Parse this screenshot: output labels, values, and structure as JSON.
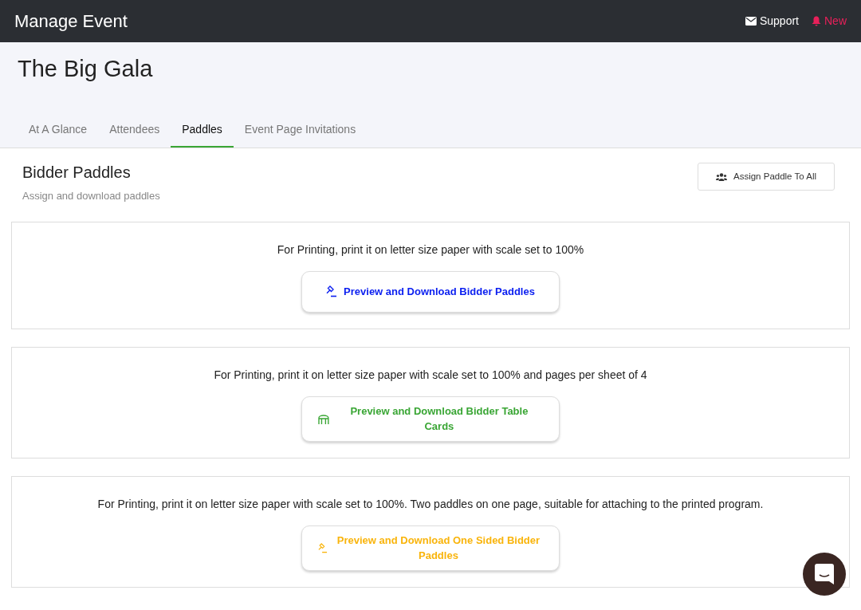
{
  "navbar": {
    "title": "Manage Event",
    "support": "Support",
    "new": "New"
  },
  "event": {
    "title": "The Big Gala"
  },
  "tabs": [
    {
      "label": "At A Glance",
      "selected": false
    },
    {
      "label": "Attendees",
      "selected": false
    },
    {
      "label": "Paddles",
      "selected": true
    },
    {
      "label": "Event Page Invitations",
      "selected": false
    }
  ],
  "section": {
    "title": "Bidder Paddles",
    "subtitle": "Assign and download paddles",
    "action": "Assign Paddle To All"
  },
  "panels": [
    {
      "note": "For Printing, print it on letter size paper with scale set to 100%",
      "button": "Preview and Download Bidder Paddles",
      "kind": "gavel",
      "color": "#0a1ef0"
    },
    {
      "note": "For Printing, print it on letter size paper with scale set to 100% and pages per sheet of 4",
      "button": "Preview and Download Bidder Table Cards",
      "kind": "table",
      "color": "#3aa635"
    },
    {
      "note": "For Printing, print it on letter size paper with scale set to 100%. Two paddles on one page, suitable for attaching to the printed program.",
      "button": "Preview and Download One Sided Bidder Paddles",
      "kind": "gavel",
      "color": "#f9b40b"
    }
  ]
}
